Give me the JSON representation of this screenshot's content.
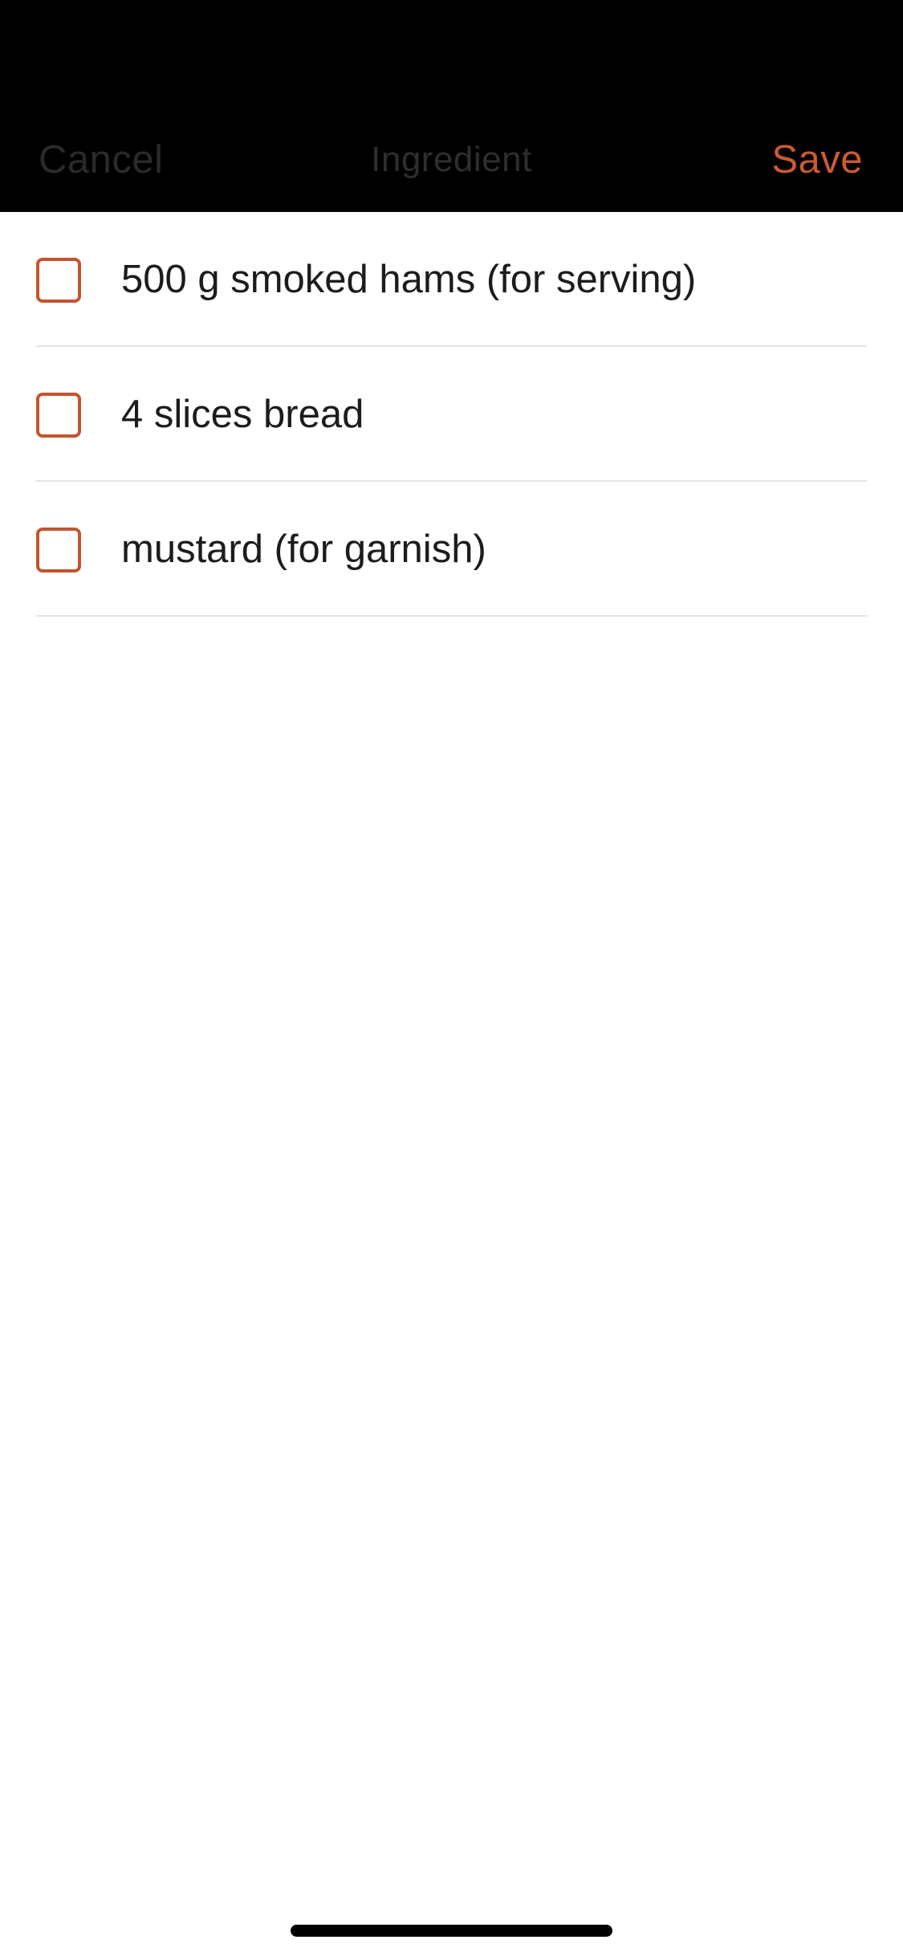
{
  "header": {
    "cancel_label": "Cancel",
    "title": "Ingredient",
    "save_label": "Save"
  },
  "ingredients": [
    {
      "label": "500 g smoked hams (for serving)",
      "checked": false
    },
    {
      "label": "4 slices bread",
      "checked": false
    },
    {
      "label": "mustard (for garnish)",
      "checked": false
    }
  ],
  "colors": {
    "accent": "#cc5a33",
    "header_background": "#000000",
    "divider": "#e4e4e4"
  }
}
